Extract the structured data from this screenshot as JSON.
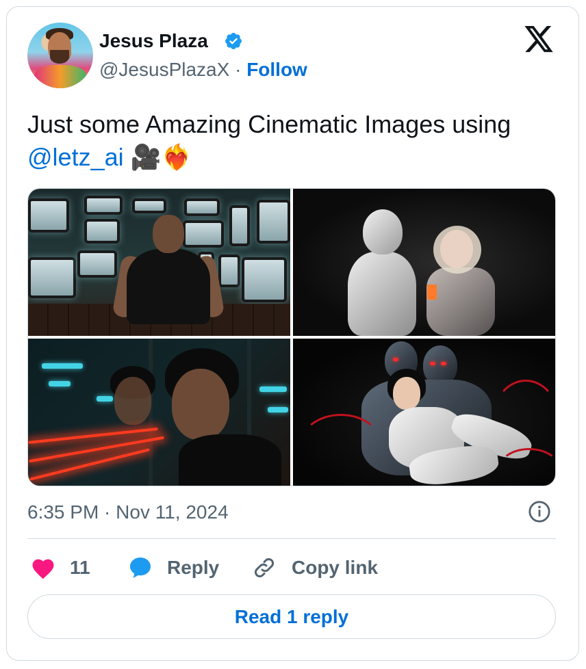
{
  "author": {
    "name": "Jesus Plaza",
    "handle": "@JesusPlazaX",
    "separator": "·",
    "follow_label": "Follow",
    "verified": true,
    "verified_color": "#1d9bf0"
  },
  "tweet": {
    "text": "Just some Amazing Cinematic Images using",
    "mention": "@letz_ai",
    "emojis": "🎥❤️‍🔥",
    "timestamp": "6:35 PM · Nov 11, 2024"
  },
  "media": {
    "images": [
      {
        "description_icon": "tv-wall-man-image"
      },
      {
        "description_icon": "robot-embrace-image"
      },
      {
        "description_icon": "neon-window-image"
      },
      {
        "description_icon": "robots-woman-image"
      }
    ]
  },
  "actions": {
    "like_count": "11",
    "reply_label": "Reply",
    "copy_label": "Copy link"
  },
  "read_replies_label": "Read 1 reply",
  "colors": {
    "link": "#006fd6",
    "heart": "#f91880",
    "reply_bubble": "#1d9bf0",
    "muted_text": "#536471",
    "border": "#cfd9de"
  }
}
